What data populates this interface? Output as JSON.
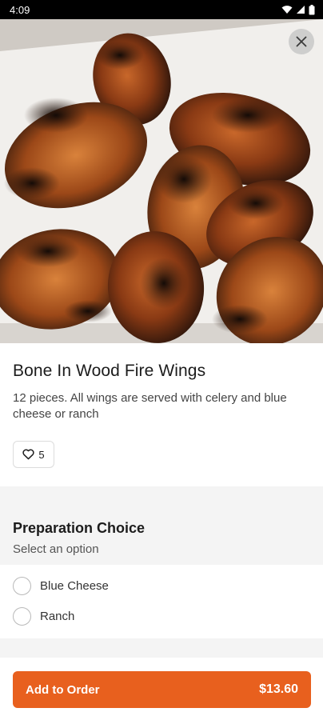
{
  "status_bar": {
    "time": "4:09"
  },
  "item": {
    "title": "Bone In Wood Fire Wings",
    "description": "12 pieces. All wings are served with celery and blue cheese or ranch",
    "likes": "5"
  },
  "preparation": {
    "title": "Preparation Choice",
    "subtitle": "Select an option",
    "options": [
      {
        "label": "Blue Cheese"
      },
      {
        "label": "Ranch"
      }
    ]
  },
  "cart": {
    "add_label": "Add to Order",
    "price": "$13.60"
  },
  "colors": {
    "accent": "#e8601e",
    "section_bg": "#f4f4f4"
  },
  "icons": [
    "wifi-icon",
    "cellular-icon",
    "battery-icon",
    "close-icon",
    "heart-icon"
  ]
}
